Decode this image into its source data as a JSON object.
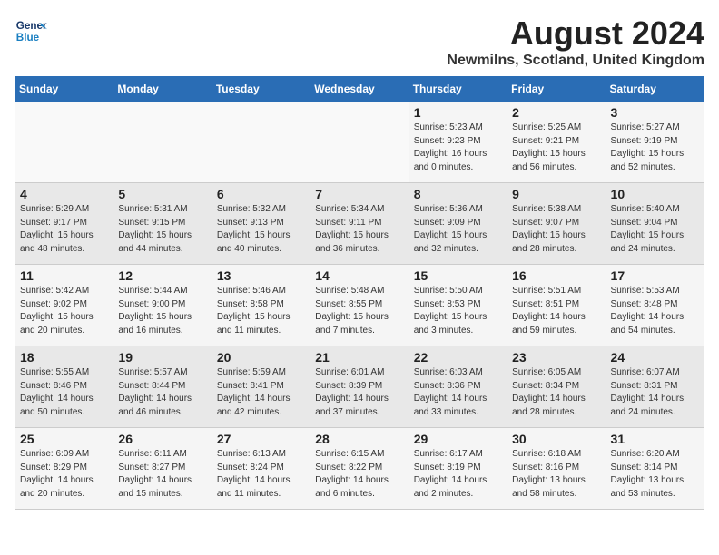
{
  "header": {
    "logo_line1": "General",
    "logo_line2": "Blue",
    "title": "August 2024",
    "subtitle": "Newmilns, Scotland, United Kingdom"
  },
  "days_of_week": [
    "Sunday",
    "Monday",
    "Tuesday",
    "Wednesday",
    "Thursday",
    "Friday",
    "Saturday"
  ],
  "weeks": [
    [
      {
        "day": "",
        "info": ""
      },
      {
        "day": "",
        "info": ""
      },
      {
        "day": "",
        "info": ""
      },
      {
        "day": "",
        "info": ""
      },
      {
        "day": "1",
        "info": "Sunrise: 5:23 AM\nSunset: 9:23 PM\nDaylight: 16 hours\nand 0 minutes."
      },
      {
        "day": "2",
        "info": "Sunrise: 5:25 AM\nSunset: 9:21 PM\nDaylight: 15 hours\nand 56 minutes."
      },
      {
        "day": "3",
        "info": "Sunrise: 5:27 AM\nSunset: 9:19 PM\nDaylight: 15 hours\nand 52 minutes."
      }
    ],
    [
      {
        "day": "4",
        "info": "Sunrise: 5:29 AM\nSunset: 9:17 PM\nDaylight: 15 hours\nand 48 minutes."
      },
      {
        "day": "5",
        "info": "Sunrise: 5:31 AM\nSunset: 9:15 PM\nDaylight: 15 hours\nand 44 minutes."
      },
      {
        "day": "6",
        "info": "Sunrise: 5:32 AM\nSunset: 9:13 PM\nDaylight: 15 hours\nand 40 minutes."
      },
      {
        "day": "7",
        "info": "Sunrise: 5:34 AM\nSunset: 9:11 PM\nDaylight: 15 hours\nand 36 minutes."
      },
      {
        "day": "8",
        "info": "Sunrise: 5:36 AM\nSunset: 9:09 PM\nDaylight: 15 hours\nand 32 minutes."
      },
      {
        "day": "9",
        "info": "Sunrise: 5:38 AM\nSunset: 9:07 PM\nDaylight: 15 hours\nand 28 minutes."
      },
      {
        "day": "10",
        "info": "Sunrise: 5:40 AM\nSunset: 9:04 PM\nDaylight: 15 hours\nand 24 minutes."
      }
    ],
    [
      {
        "day": "11",
        "info": "Sunrise: 5:42 AM\nSunset: 9:02 PM\nDaylight: 15 hours\nand 20 minutes."
      },
      {
        "day": "12",
        "info": "Sunrise: 5:44 AM\nSunset: 9:00 PM\nDaylight: 15 hours\nand 16 minutes."
      },
      {
        "day": "13",
        "info": "Sunrise: 5:46 AM\nSunset: 8:58 PM\nDaylight: 15 hours\nand 11 minutes."
      },
      {
        "day": "14",
        "info": "Sunrise: 5:48 AM\nSunset: 8:55 PM\nDaylight: 15 hours\nand 7 minutes."
      },
      {
        "day": "15",
        "info": "Sunrise: 5:50 AM\nSunset: 8:53 PM\nDaylight: 15 hours\nand 3 minutes."
      },
      {
        "day": "16",
        "info": "Sunrise: 5:51 AM\nSunset: 8:51 PM\nDaylight: 14 hours\nand 59 minutes."
      },
      {
        "day": "17",
        "info": "Sunrise: 5:53 AM\nSunset: 8:48 PM\nDaylight: 14 hours\nand 54 minutes."
      }
    ],
    [
      {
        "day": "18",
        "info": "Sunrise: 5:55 AM\nSunset: 8:46 PM\nDaylight: 14 hours\nand 50 minutes."
      },
      {
        "day": "19",
        "info": "Sunrise: 5:57 AM\nSunset: 8:44 PM\nDaylight: 14 hours\nand 46 minutes."
      },
      {
        "day": "20",
        "info": "Sunrise: 5:59 AM\nSunset: 8:41 PM\nDaylight: 14 hours\nand 42 minutes."
      },
      {
        "day": "21",
        "info": "Sunrise: 6:01 AM\nSunset: 8:39 PM\nDaylight: 14 hours\nand 37 minutes."
      },
      {
        "day": "22",
        "info": "Sunrise: 6:03 AM\nSunset: 8:36 PM\nDaylight: 14 hours\nand 33 minutes."
      },
      {
        "day": "23",
        "info": "Sunrise: 6:05 AM\nSunset: 8:34 PM\nDaylight: 14 hours\nand 28 minutes."
      },
      {
        "day": "24",
        "info": "Sunrise: 6:07 AM\nSunset: 8:31 PM\nDaylight: 14 hours\nand 24 minutes."
      }
    ],
    [
      {
        "day": "25",
        "info": "Sunrise: 6:09 AM\nSunset: 8:29 PM\nDaylight: 14 hours\nand 20 minutes."
      },
      {
        "day": "26",
        "info": "Sunrise: 6:11 AM\nSunset: 8:27 PM\nDaylight: 14 hours\nand 15 minutes."
      },
      {
        "day": "27",
        "info": "Sunrise: 6:13 AM\nSunset: 8:24 PM\nDaylight: 14 hours\nand 11 minutes."
      },
      {
        "day": "28",
        "info": "Sunrise: 6:15 AM\nSunset: 8:22 PM\nDaylight: 14 hours\nand 6 minutes."
      },
      {
        "day": "29",
        "info": "Sunrise: 6:17 AM\nSunset: 8:19 PM\nDaylight: 14 hours\nand 2 minutes."
      },
      {
        "day": "30",
        "info": "Sunrise: 6:18 AM\nSunset: 8:16 PM\nDaylight: 13 hours\nand 58 minutes."
      },
      {
        "day": "31",
        "info": "Sunrise: 6:20 AM\nSunset: 8:14 PM\nDaylight: 13 hours\nand 53 minutes."
      }
    ]
  ]
}
